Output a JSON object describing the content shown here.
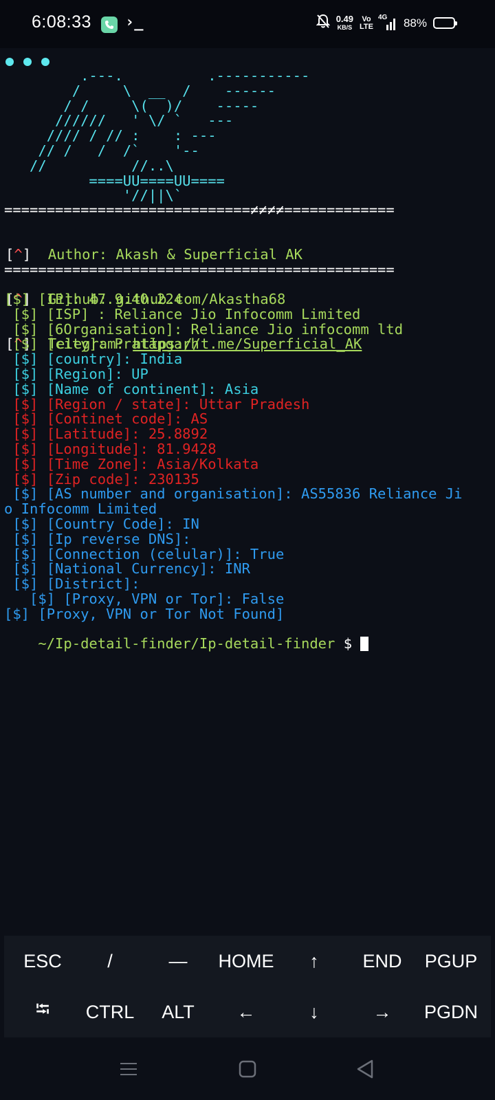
{
  "status_bar": {
    "time": "6:08:33",
    "term_glyph": "›_",
    "net_speed_value": "0.49",
    "net_speed_unit": "KB/S",
    "volte_top": "Vo",
    "volte_bottom": "LTE",
    "network": "4G",
    "battery_pct": "88%",
    "battery_level": 0.88
  },
  "terminal": {
    "ascii_art": "         .---.          .-----------\n        /     \\  __  /    ------\n       / /     \\(  )/    -----\n      //////   ' \\/ `   ---\n     //// / // :    : ---\n    // /   /  /`    '--\n   //          //..\\\n          ====UU====UU====\n              '//||\\`",
    "separator_top": "=============================≠≠≠≠=============",
    "separator_bottom": "==============================================",
    "banner": [
      {
        "bracket": "[^]",
        "label": "Author:",
        "value": "Akash & Superficial AK"
      },
      {
        "bracket": "[^]",
        "label": "Github:",
        "value": "github.com/Akastha68"
      },
      {
        "bracket": "[^]",
        "label": "Telegram:",
        "value": "https://t.me/Superficial_AK"
      }
    ],
    "output_lines": [
      {
        "text": "[$] [IP]: 47.9.40.224",
        "color": "g"
      },
      {
        "text": " [$] [ISP] : Reliance Jio Infocomm Limited",
        "color": "g"
      },
      {
        "text": " [$] [6Organisation]: Reliance Jio infocomm ltd",
        "color": "g"
      },
      {
        "text": " [$] [city]: Pratāpgarh",
        "color": "g"
      },
      {
        "text": " [$] [country]: India",
        "color": "c"
      },
      {
        "text": " [$] [Region]: UP",
        "color": "c"
      },
      {
        "text": " [$] [Name of continent]: Asia",
        "color": "c"
      },
      {
        "text": " [$] [Region / state]: Uttar Pradesh",
        "color": "r"
      },
      {
        "text": " [$] [Continet code]: AS",
        "color": "r"
      },
      {
        "text": " [$] [Latitude]: 25.8892",
        "color": "r"
      },
      {
        "text": " [$] [Longitude]: 81.9428",
        "color": "r"
      },
      {
        "text": " [$] [Time Zone]: Asia/Kolkata",
        "color": "r"
      },
      {
        "text": " [$] [Zip code]: 230135",
        "color": "r"
      },
      {
        "text": " [$] [AS number and organisation]: AS55836 Reliance Ji",
        "color": "b"
      },
      {
        "text": "o Infocomm Limited",
        "color": "b"
      },
      {
        "text": " [$] [Country Code]: IN",
        "color": "b"
      },
      {
        "text": " [$] [Ip reverse DNS]:",
        "color": "b"
      },
      {
        "text": " [$] [Connection (celular)]: True",
        "color": "b"
      },
      {
        "text": " [$] [National Currency]: INR",
        "color": "b"
      },
      {
        "text": " [$] [District]:",
        "color": "b"
      },
      {
        "text": "   [$] [Proxy, VPN or Tor]: False",
        "color": "b"
      },
      {
        "text": "[$] [Proxy, VPN or Tor Not Found]",
        "color": "b"
      }
    ],
    "prompt_path": "~/Ip-detail-finder/Ip-detail-finder",
    "prompt_symbol": " $ "
  },
  "extra_keys": {
    "row1": [
      "ESC",
      "/",
      "—",
      "HOME",
      "↑",
      "END",
      "PGUP"
    ],
    "row2": [
      "⭾",
      "CTRL",
      "ALT",
      "←",
      "↓",
      "→",
      "PGDN"
    ]
  },
  "nav_bar": {
    "icons": [
      "menu-icon",
      "home-icon",
      "back-icon"
    ]
  }
}
